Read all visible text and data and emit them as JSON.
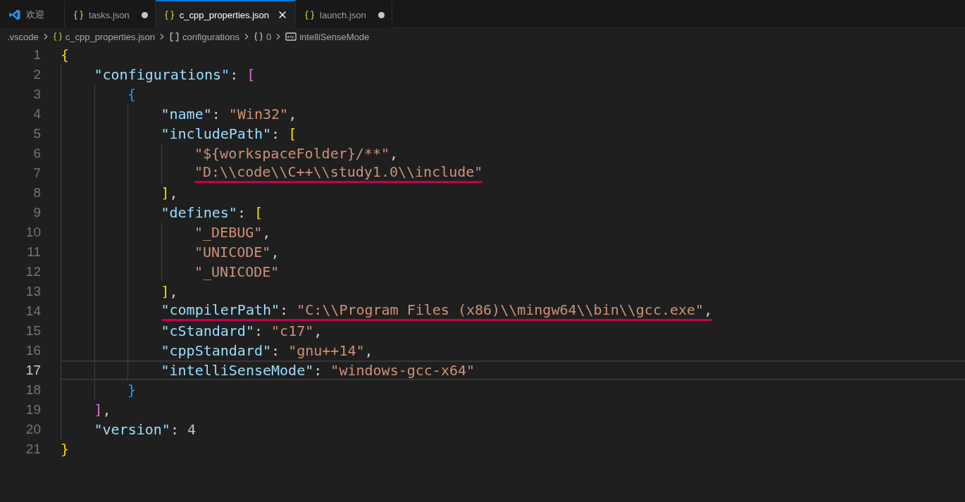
{
  "tabs": [
    {
      "label": "欢迎",
      "kind": "welcome",
      "selected": false,
      "modified": false
    },
    {
      "label": "tasks.json",
      "kind": "json",
      "selected": false,
      "modified": true
    },
    {
      "label": "c_cpp_properties.json",
      "kind": "json",
      "selected": true,
      "modified": false
    },
    {
      "label": "launch.json",
      "kind": "json",
      "selected": false,
      "modified": true
    }
  ],
  "breadcrumbs": [
    {
      "kind": "folder",
      "label": ".vscode"
    },
    {
      "kind": "file",
      "label": "c_cpp_properties.json"
    },
    {
      "kind": "array",
      "label": "configurations"
    },
    {
      "kind": "object",
      "label": "0"
    },
    {
      "kind": "string",
      "label": "intelliSenseMode"
    }
  ],
  "lines": [
    {
      "number": "1",
      "selected": false,
      "tokens": [
        {
          "kind": "bracket",
          "text": "{",
          "color": "#ffd700"
        }
      ],
      "children": [
        {
          "number": "2",
          "selected": false,
          "tokens": [
            {
              "kind": "key",
              "text": "\"configurations\""
            },
            {
              "kind": "punct",
              "text": ": "
            },
            {
              "kind": "bracket",
              "text": "[",
              "color": "#da70d6"
            }
          ],
          "children": [
            {
              "number": "3",
              "selected": false,
              "tokens": [
                {
                  "kind": "bracket",
                  "text": "{",
                  "color": "#179fff"
                }
              ],
              "children": [
                {
                  "number": "4",
                  "selected": false,
                  "tokens": [
                    {
                      "kind": "key",
                      "text": "\"name\""
                    },
                    {
                      "kind": "punct",
                      "text": ": "
                    },
                    {
                      "kind": "string",
                      "text": "\"Win32\""
                    },
                    {
                      "kind": "punct",
                      "text": ","
                    }
                  ]
                },
                {
                  "number": "5",
                  "selected": false,
                  "tokens": [
                    {
                      "kind": "key",
                      "text": "\"includePath\""
                    },
                    {
                      "kind": "punct",
                      "text": ": "
                    },
                    {
                      "kind": "bracket",
                      "text": "[",
                      "color": "#ffd700"
                    }
                  ],
                  "children": [
                    {
                      "number": "6",
                      "selected": false,
                      "tokens": [
                        {
                          "kind": "string",
                          "text": "\"${workspaceFolder}/**\""
                        },
                        {
                          "kind": "punct",
                          "text": ","
                        }
                      ]
                    },
                    {
                      "number": "7",
                      "selected": false,
                      "tokens": [
                        {
                          "kind": "string",
                          "text": "\"D:\\\\code\\\\C++\\\\study1.0\\\\include\"",
                          "underlined": true
                        }
                      ]
                    }
                  ]
                },
                {
                  "number": "8",
                  "selected": false,
                  "tokens": [
                    {
                      "kind": "bracket",
                      "text": "]",
                      "color": "#ffd700"
                    },
                    {
                      "kind": "punct",
                      "text": ","
                    }
                  ]
                },
                {
                  "number": "9",
                  "selected": false,
                  "tokens": [
                    {
                      "kind": "key",
                      "text": "\"defines\""
                    },
                    {
                      "kind": "punct",
                      "text": ": "
                    },
                    {
                      "kind": "bracket",
                      "text": "[",
                      "color": "#ffd700"
                    }
                  ],
                  "children": [
                    {
                      "number": "10",
                      "selected": false,
                      "tokens": [
                        {
                          "kind": "string",
                          "text": "\"_DEBUG\""
                        },
                        {
                          "kind": "punct",
                          "text": ","
                        }
                      ]
                    },
                    {
                      "number": "11",
                      "selected": false,
                      "tokens": [
                        {
                          "kind": "string",
                          "text": "\"UNICODE\""
                        },
                        {
                          "kind": "punct",
                          "text": ","
                        }
                      ]
                    },
                    {
                      "number": "12",
                      "selected": false,
                      "tokens": [
                        {
                          "kind": "string",
                          "text": "\"_UNICODE\""
                        }
                      ]
                    }
                  ]
                },
                {
                  "number": "13",
                  "selected": false,
                  "tokens": [
                    {
                      "kind": "bracket",
                      "text": "]",
                      "color": "#ffd700"
                    },
                    {
                      "kind": "punct",
                      "text": ","
                    }
                  ]
                },
                {
                  "number": "14",
                  "selected": false,
                  "tokens": [
                    {
                      "kind": "key",
                      "text": "\"compilerPath\"",
                      "underlined": true
                    },
                    {
                      "kind": "punct",
                      "text": ": ",
                      "underlined": true
                    },
                    {
                      "kind": "string",
                      "text": "\"C:\\\\Program Files (x86)\\\\mingw64\\\\bin\\\\gcc.exe\"",
                      "underlined": true
                    },
                    {
                      "kind": "punct",
                      "text": ",",
                      "underlined": true
                    }
                  ]
                },
                {
                  "number": "15",
                  "selected": false,
                  "tokens": [
                    {
                      "kind": "key",
                      "text": "\"cStandard\""
                    },
                    {
                      "kind": "punct",
                      "text": ": "
                    },
                    {
                      "kind": "string",
                      "text": "\"c17\""
                    },
                    {
                      "kind": "punct",
                      "text": ","
                    }
                  ]
                },
                {
                  "number": "16",
                  "selected": false,
                  "tokens": [
                    {
                      "kind": "key",
                      "text": "\"cppStandard\""
                    },
                    {
                      "kind": "punct",
                      "text": ": "
                    },
                    {
                      "kind": "string",
                      "text": "\"gnu++14\""
                    },
                    {
                      "kind": "punct",
                      "text": ","
                    }
                  ]
                },
                {
                  "number": "17",
                  "selected": true,
                  "tokens": [
                    {
                      "kind": "key",
                      "text": "\"intelliSenseMode\""
                    },
                    {
                      "kind": "punct",
                      "text": ": "
                    },
                    {
                      "kind": "string",
                      "text": "\"windows-gcc-x64\""
                    }
                  ]
                }
              ]
            },
            {
              "number": "18",
              "selected": false,
              "tokens": [
                {
                  "kind": "bracket",
                  "text": "}",
                  "color": "#179fff"
                }
              ]
            }
          ]
        },
        {
          "number": "19",
          "selected": false,
          "tokens": [
            {
              "kind": "bracket",
              "text": "]",
              "color": "#da70d6"
            },
            {
              "kind": "punct",
              "text": ","
            }
          ]
        },
        {
          "number": "20",
          "selected": false,
          "tokens": [
            {
              "kind": "key",
              "text": "\"version\""
            },
            {
              "kind": "punct",
              "text": ": "
            },
            {
              "kind": "number",
              "text": "4"
            }
          ]
        }
      ]
    },
    {
      "number": "21",
      "selected": false,
      "tokens": [
        {
          "kind": "bracket",
          "text": "}",
          "color": "#ffd700"
        }
      ]
    }
  ]
}
